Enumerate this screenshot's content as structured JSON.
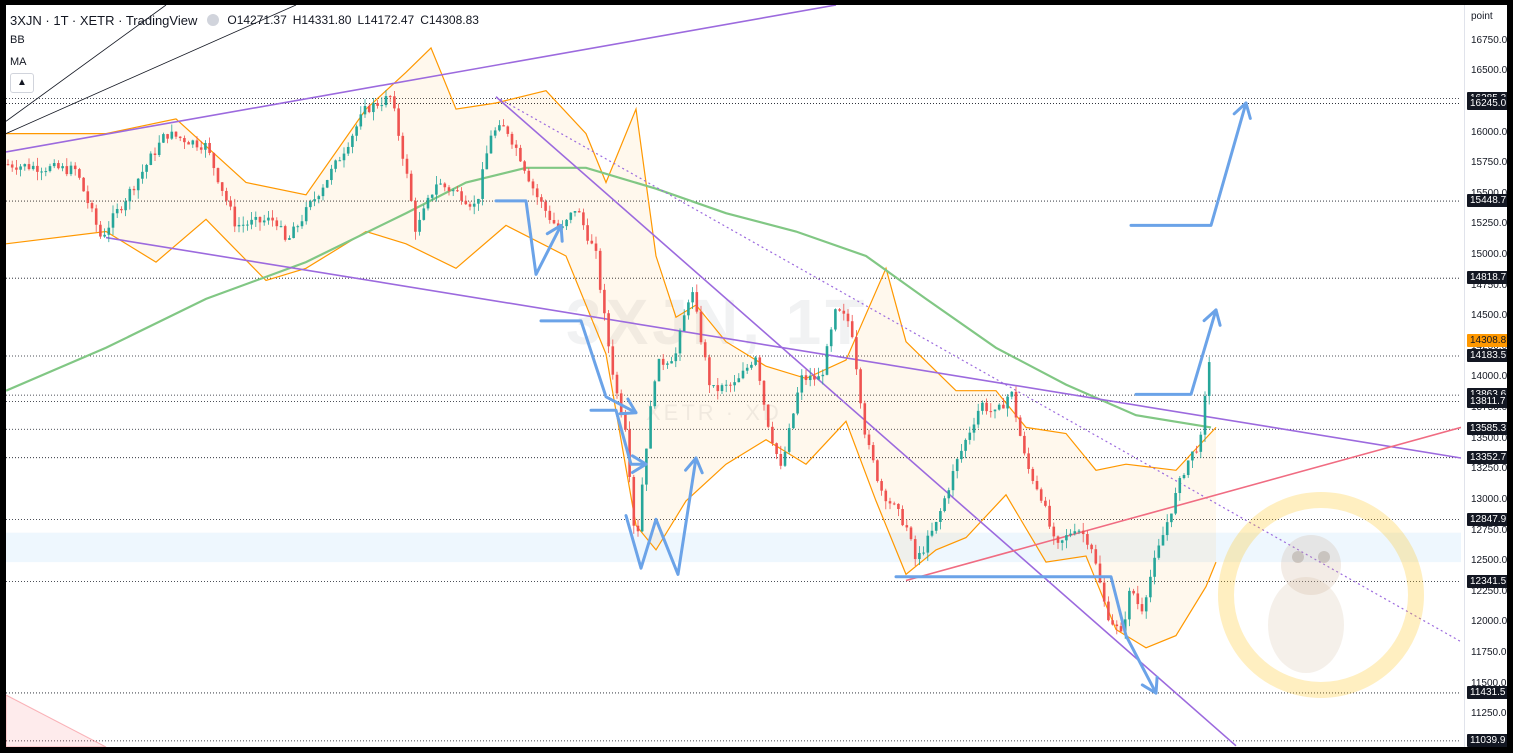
{
  "legend": {
    "symbol": "3XJN · 1T · XETR · TradingView",
    "open": "O14271.37",
    "high": "H14331.80",
    "low": "L14172.47",
    "close": "C14308.83",
    "indicators": [
      "BB",
      "MA"
    ],
    "collapse_icon": "chevron-up-icon"
  },
  "watermark": {
    "symbol": "3XJN, 1T",
    "exchange": "XETR · XD"
  },
  "axis": {
    "unit": "point",
    "ticks": [
      "16750.0",
      "16500.0",
      "16250.0",
      "16000.0",
      "15750.0",
      "15500.0",
      "15250.0",
      "15000.0",
      "14750.0",
      "14500.0",
      "14250.0",
      "14000.0",
      "13750.0",
      "13500.0",
      "13250.0",
      "13000.0",
      "12750.0",
      "12500.0",
      "12250.0",
      "12000.0",
      "11750.0",
      "11500.0",
      "11250.0",
      "11000.0"
    ],
    "level_tags": [
      "16285.3",
      "16245.0",
      "15448.7",
      "14818.7",
      "14183.5",
      "13863.6",
      "13811.7",
      "13585.3",
      "13352.7",
      "12847.9",
      "12341.5",
      "11431.5",
      "11039.9"
    ],
    "current_tag": "14308.8"
  },
  "chart_data": {
    "type": "candlestick",
    "symbol": "3XJN",
    "interval": "1T",
    "exchange": "XETR",
    "ylim": [
      10990,
      17050
    ],
    "y_scale": "linear",
    "grid": false,
    "last": {
      "open": 14271.37,
      "high": 14331.8,
      "low": 14172.47,
      "close": 14308.83
    },
    "horizontal_levels": [
      16285.3,
      16245.0,
      15448.7,
      14818.7,
      14183.5,
      13863.6,
      13811.7,
      13585.3,
      13352.7,
      12847.9,
      12341.5,
      11431.5,
      11039.9
    ],
    "highlighted_zone": [
      12500,
      12740
    ],
    "price_path_knots": [
      [
        0,
        15750
      ],
      [
        70,
        15700
      ],
      [
        95,
        15150
      ],
      [
        160,
        16000
      ],
      [
        200,
        15900
      ],
      [
        230,
        15250
      ],
      [
        270,
        15300
      ],
      [
        280,
        15100
      ],
      [
        330,
        15750
      ],
      [
        360,
        16200
      ],
      [
        385,
        16300
      ],
      [
        400,
        15700
      ],
      [
        410,
        15200
      ],
      [
        430,
        15600
      ],
      [
        455,
        15500
      ],
      [
        470,
        15400
      ],
      [
        485,
        16000
      ],
      [
        500,
        16050
      ],
      [
        515,
        15800
      ],
      [
        530,
        15500
      ],
      [
        545,
        15300
      ],
      [
        555,
        15200
      ],
      [
        570,
        15400
      ],
      [
        590,
        15000
      ],
      [
        600,
        14400
      ],
      [
        610,
        13900
      ],
      [
        620,
        13600
      ],
      [
        630,
        12600
      ],
      [
        638,
        13300
      ],
      [
        650,
        14100
      ],
      [
        670,
        14200
      ],
      [
        685,
        14750
      ],
      [
        705,
        13900
      ],
      [
        730,
        13950
      ],
      [
        750,
        14200
      ],
      [
        760,
        13700
      ],
      [
        775,
        13250
      ],
      [
        795,
        14000
      ],
      [
        815,
        14000
      ],
      [
        830,
        14550
      ],
      [
        845,
        14450
      ],
      [
        860,
        13500
      ],
      [
        875,
        13100
      ],
      [
        900,
        12800
      ],
      [
        910,
        12500
      ],
      [
        930,
        12800
      ],
      [
        950,
        13300
      ],
      [
        975,
        13800
      ],
      [
        990,
        13700
      ],
      [
        1005,
        13900
      ],
      [
        1020,
        13300
      ],
      [
        1035,
        13050
      ],
      [
        1050,
        12600
      ],
      [
        1070,
        12800
      ],
      [
        1085,
        12650
      ],
      [
        1100,
        12100
      ],
      [
        1115,
        11900
      ],
      [
        1125,
        12300
      ],
      [
        1135,
        12100
      ],
      [
        1145,
        12400
      ],
      [
        1160,
        12800
      ],
      [
        1180,
        13300
      ],
      [
        1195,
        13500
      ],
      [
        1205,
        14300
      ]
    ],
    "bollinger_bands": {
      "upper": [
        [
          0,
          16000
        ],
        [
          100,
          16000
        ],
        [
          170,
          16120
        ],
        [
          240,
          15600
        ],
        [
          300,
          15500
        ],
        [
          360,
          16200
        ],
        [
          400,
          16500
        ],
        [
          425,
          16700
        ],
        [
          450,
          16200
        ],
        [
          490,
          16250
        ],
        [
          540,
          16350
        ],
        [
          580,
          16000
        ],
        [
          600,
          15600
        ],
        [
          630,
          16200
        ],
        [
          650,
          15000
        ],
        [
          670,
          14500
        ],
        [
          690,
          14600
        ],
        [
          720,
          14300
        ],
        [
          760,
          14100
        ],
        [
          800,
          14000
        ],
        [
          840,
          14150
        ],
        [
          880,
          14900
        ],
        [
          900,
          14300
        ],
        [
          950,
          13900
        ],
        [
          990,
          13900
        ],
        [
          1020,
          13600
        ],
        [
          1060,
          13550
        ],
        [
          1090,
          13250
        ],
        [
          1120,
          13300
        ],
        [
          1170,
          13250
        ],
        [
          1210,
          13600
        ]
      ],
      "lower": [
        [
          0,
          15100
        ],
        [
          100,
          15200
        ],
        [
          150,
          14950
        ],
        [
          200,
          15300
        ],
        [
          260,
          14800
        ],
        [
          300,
          14900
        ],
        [
          360,
          15200
        ],
        [
          400,
          15100
        ],
        [
          450,
          14900
        ],
        [
          500,
          15250
        ],
        [
          560,
          15000
        ],
        [
          600,
          14200
        ],
        [
          630,
          12800
        ],
        [
          650,
          12600
        ],
        [
          680,
          13000
        ],
        [
          720,
          13300
        ],
        [
          760,
          13500
        ],
        [
          800,
          13300
        ],
        [
          840,
          13650
        ],
        [
          870,
          13000
        ],
        [
          900,
          12400
        ],
        [
          930,
          12600
        ],
        [
          960,
          12700
        ],
        [
          1000,
          13050
        ],
        [
          1040,
          12500
        ],
        [
          1080,
          12550
        ],
        [
          1110,
          11950
        ],
        [
          1140,
          11800
        ],
        [
          1170,
          11900
        ],
        [
          1200,
          12300
        ],
        [
          1210,
          12500
        ]
      ]
    },
    "moving_average": [
      [
        0,
        13900
      ],
      [
        100,
        14250
      ],
      [
        200,
        14650
      ],
      [
        300,
        14950
      ],
      [
        400,
        15350
      ],
      [
        460,
        15600
      ],
      [
        520,
        15720
      ],
      [
        580,
        15720
      ],
      [
        650,
        15550
      ],
      [
        720,
        15350
      ],
      [
        790,
        15200
      ],
      [
        860,
        15000
      ],
      [
        920,
        14650
      ],
      [
        990,
        14250
      ],
      [
        1060,
        13950
      ],
      [
        1130,
        13700
      ],
      [
        1205,
        13600
      ]
    ],
    "trend_lines": [
      {
        "color": "#9c6ade",
        "points": [
          [
            0,
            15850
          ],
          [
            830,
            17050
          ]
        ]
      },
      {
        "color": "#9c6ade",
        "points": [
          [
            100,
            15150
          ],
          [
            1455,
            13350
          ]
        ]
      },
      {
        "color": "#9c6ade",
        "points": [
          [
            490,
            16300
          ],
          [
            1230,
            11000
          ]
        ]
      },
      {
        "color": "#9c6ade",
        "style": "dotted",
        "points": [
          [
            490,
            16300
          ],
          [
            1455,
            11850
          ]
        ]
      },
      {
        "color": "#f06c82",
        "points": [
          [
            900,
            12350
          ],
          [
            1455,
            13600
          ]
        ]
      },
      {
        "color": "#131722",
        "points": [
          [
            0,
            16100
          ],
          [
            160,
            17050
          ]
        ]
      },
      {
        "color": "#131722",
        "points": [
          [
            0,
            16000
          ],
          [
            290,
            17050
          ]
        ]
      }
    ],
    "arrows": [
      {
        "color": "#6ba3e8",
        "points": [
          [
            490,
            15450
          ],
          [
            520,
            15450
          ],
          [
            530,
            14850
          ],
          [
            555,
            15250
          ]
        ]
      },
      {
        "color": "#6ba3e8",
        "points": [
          [
            535,
            14470
          ],
          [
            575,
            14470
          ],
          [
            600,
            13850
          ],
          [
            630,
            13720
          ]
        ]
      },
      {
        "color": "#6ba3e8",
        "points": [
          [
            585,
            13740
          ],
          [
            610,
            13740
          ],
          [
            625,
            13300
          ],
          [
            640,
            13300
          ]
        ]
      },
      {
        "color": "#6ba3e8",
        "points": [
          [
            620,
            12880
          ],
          [
            635,
            12450
          ],
          [
            650,
            12850
          ],
          [
            672,
            12400
          ],
          [
            690,
            13350
          ]
        ]
      },
      {
        "color": "#6ba3e8",
        "points": [
          [
            890,
            12380
          ],
          [
            1105,
            12380
          ],
          [
            1120,
            11900
          ],
          [
            1150,
            11430
          ]
        ]
      },
      {
        "color": "#6ba3e8",
        "points": [
          [
            1130,
            13870
          ],
          [
            1185,
            13870
          ],
          [
            1210,
            14560
          ]
        ]
      },
      {
        "color": "#6ba3e8",
        "points": [
          [
            1125,
            15250
          ],
          [
            1205,
            15250
          ],
          [
            1240,
            16250
          ]
        ]
      }
    ]
  }
}
